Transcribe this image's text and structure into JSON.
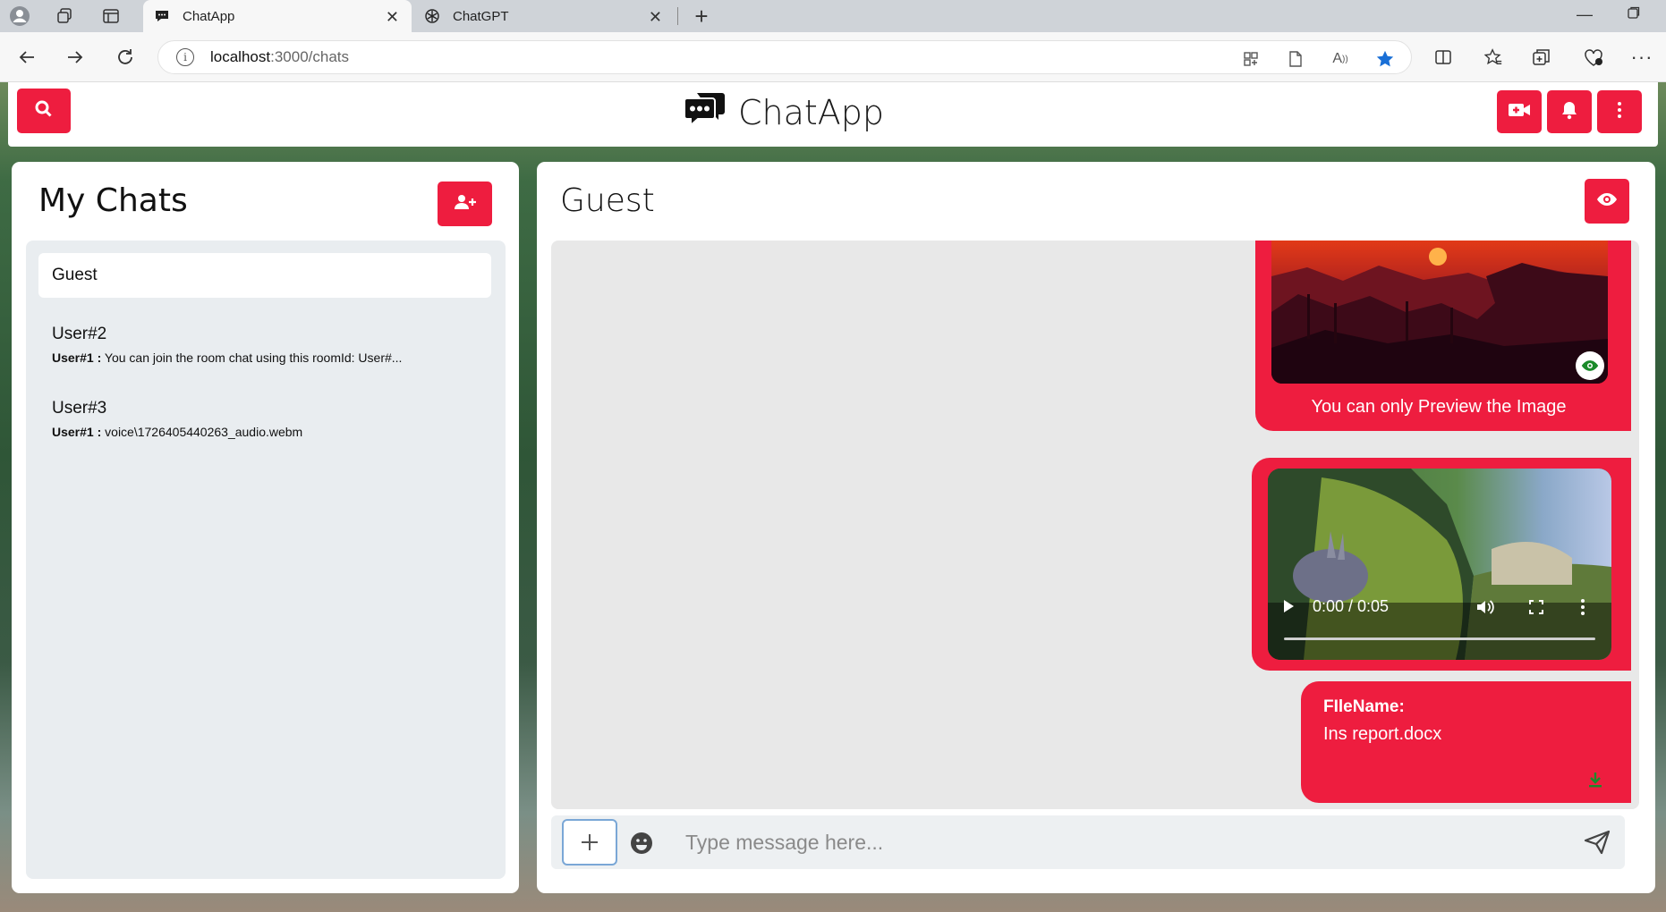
{
  "browser": {
    "tabs": [
      {
        "title": "ChatApp",
        "active": true
      },
      {
        "title": "ChatGPT",
        "active": false
      }
    ],
    "url_host": "localhost",
    "url_path": ":3000/chats"
  },
  "header": {
    "brand_title": "ChatApp"
  },
  "left_panel": {
    "title": "My Chats",
    "chats": [
      {
        "name": "Guest",
        "sender": "",
        "preview": ""
      },
      {
        "name": "User#2",
        "sender": "User#1 :",
        "preview": " You can join the room chat using this roomId: User#..."
      },
      {
        "name": "User#3",
        "sender": "User#1 :",
        "preview": " voice\\1726405440263_audio.webm"
      }
    ]
  },
  "right_panel": {
    "title": "Guest",
    "messages": {
      "image_caption": "You can only Preview the Image",
      "video_time": "0:00 / 0:05",
      "file_label": "FIleName:",
      "file_name": "Ins report.docx"
    },
    "composer": {
      "placeholder": "Type message here..."
    }
  },
  "colors": {
    "accent": "#ee1d3f",
    "panel": "#ffffff",
    "chat_list_bg": "#e9edf0",
    "msg_area_bg": "#e8e8e8",
    "eye_icon": "#1a8a2a"
  }
}
